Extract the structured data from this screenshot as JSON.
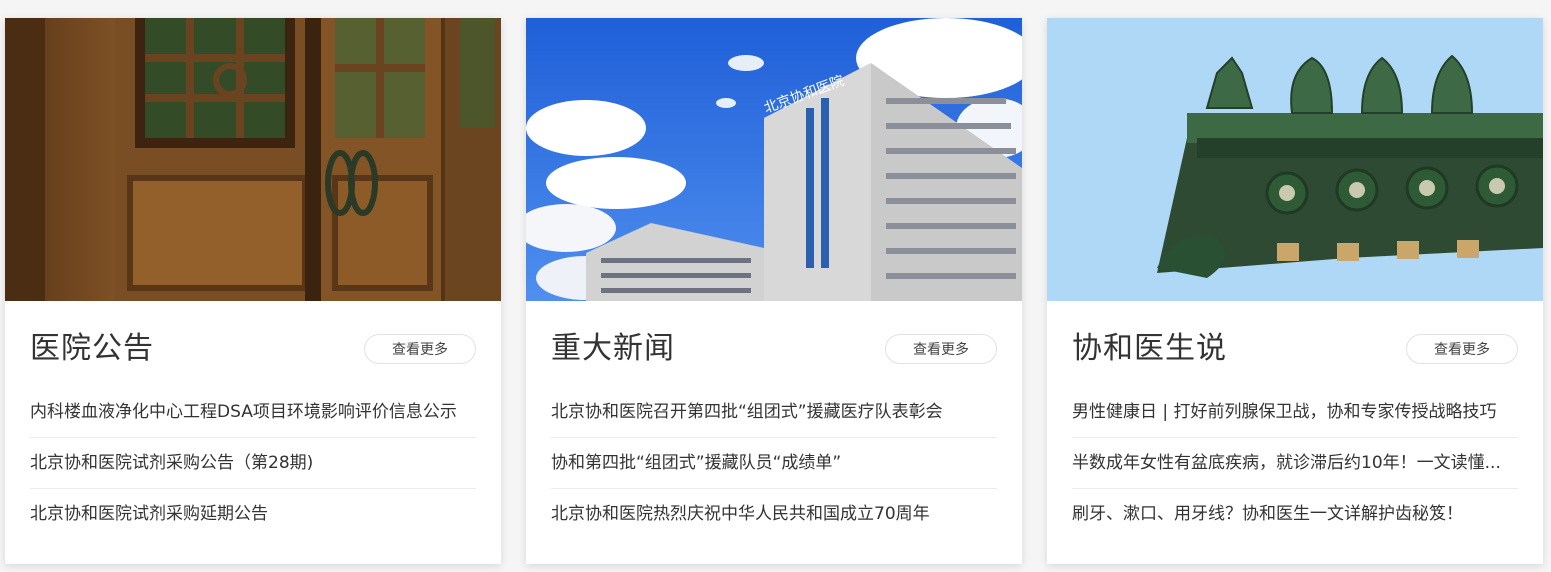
{
  "cards": [
    {
      "title": "医院公告",
      "more_label": "查看更多",
      "image": "wooden-door-photo",
      "items": [
        "内科楼血液净化中心工程DSA项目环境影响评价信息公示",
        "北京协和医院试剂采购公告（第28期)",
        "北京协和医院试剂采购延期公告"
      ]
    },
    {
      "title": "重大新闻",
      "more_label": "查看更多",
      "image": "hospital-building-photo",
      "items": [
        "北京协和医院召开第四批“组团式”援藏医疗队表彰会",
        "协和第四批“组团式”援藏队员“成绩单”",
        "北京协和医院热烈庆祝中华人民共和国成立70周年"
      ]
    },
    {
      "title": "协和医生说",
      "more_label": "查看更多",
      "image": "roof-ornament-photo",
      "items": [
        "男性健康日 | 打好前列腺保卫战，协和专家传授战略技巧",
        "半数成年女性有盆底疾病，就诊滞后约10年！一文读懂...",
        "刷牙、漱口、用牙线？协和医生一文详解护齿秘笈！"
      ]
    }
  ],
  "colors": {
    "card_bg": "#ffffff",
    "page_bg": "#f5f5f5",
    "title_text": "#333333",
    "divider": "#ececec"
  }
}
